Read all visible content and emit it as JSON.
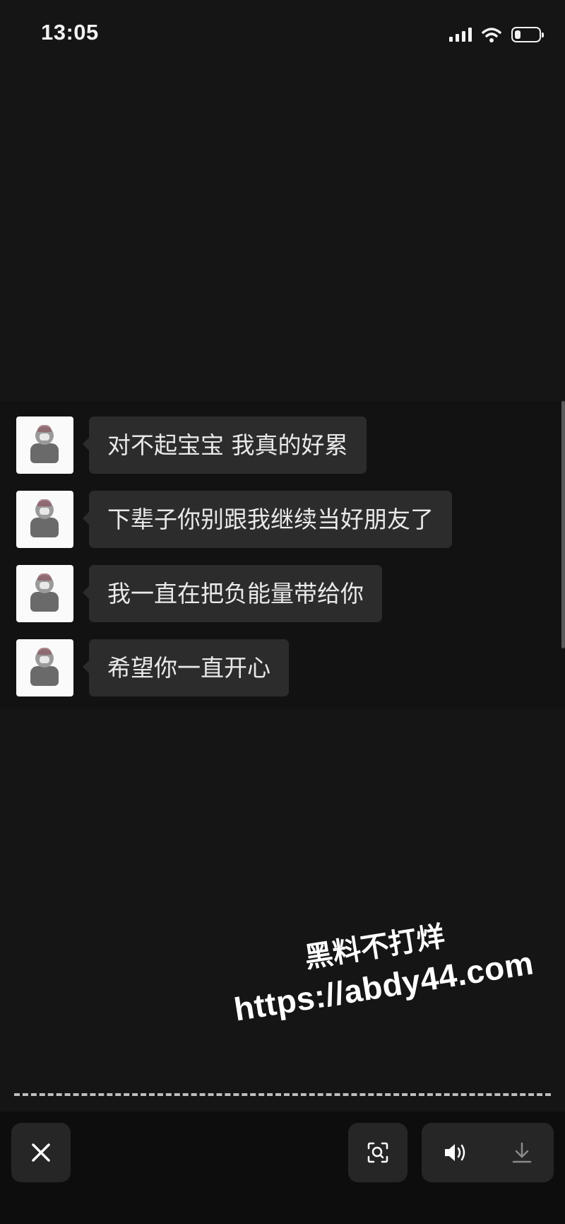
{
  "status_bar": {
    "time": "13:05",
    "icons": [
      "signal-icon",
      "wifi-icon",
      "battery-icon"
    ]
  },
  "messages": [
    {
      "text": "对不起宝宝 我真的好累"
    },
    {
      "text": "下辈子你别跟我继续当好朋友了"
    },
    {
      "text": "我一直在把负能量带给你"
    },
    {
      "text": "希望你一直开心"
    }
  ],
  "watermark": {
    "line1": "黑料不打烊",
    "line2": "https://abdy44.com"
  },
  "toolbar": {
    "icons": [
      "close-icon",
      "scan-icon",
      "volume-icon",
      "download-icon"
    ]
  },
  "colors": {
    "background": "#151515",
    "bubble": "#2c2c2c",
    "text": "#e9e9e9"
  }
}
